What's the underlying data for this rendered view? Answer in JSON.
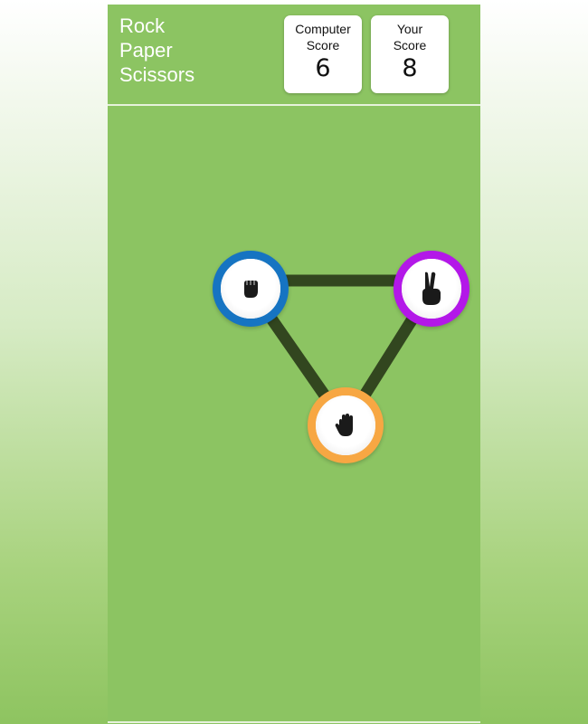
{
  "header": {
    "title_lines": [
      "Rock",
      "Paper",
      "Scissors"
    ]
  },
  "scores": {
    "computer": {
      "label_line1": "Computer",
      "label_line2": "Score",
      "value": "6"
    },
    "player": {
      "label_line1": "Your",
      "label_line2": "Score",
      "value": "8"
    }
  },
  "choices": [
    {
      "name": "rock",
      "icon": "fist-icon",
      "ring_color": "#1674c2"
    },
    {
      "name": "scissors",
      "icon": "peace-hand-icon",
      "ring_color": "#b318e8"
    },
    {
      "name": "paper",
      "icon": "open-hand-icon",
      "ring_color": "#f7a743"
    }
  ],
  "colors": {
    "background": "#8cc462",
    "connector": "#32461f",
    "card": "#ffffff"
  }
}
